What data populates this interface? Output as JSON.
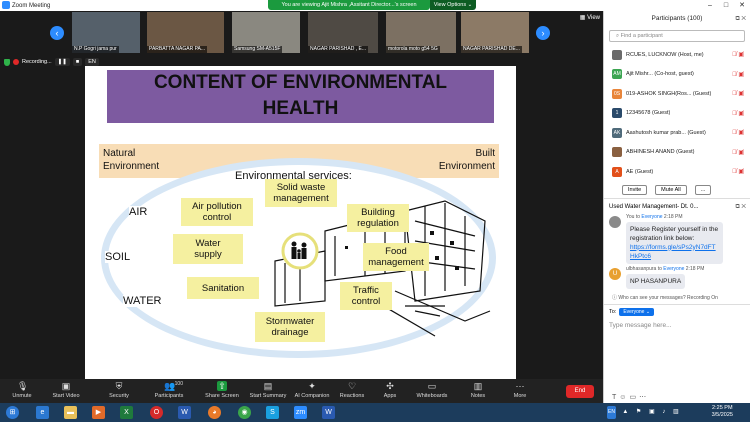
{
  "window": {
    "title": "Zoom Meeting"
  },
  "banner": {
    "viewing": "You are viewing Ajit Mishra ,Assitant Director...'s screen",
    "options": "View Options"
  },
  "thumbnails": [
    {
      "name": "N.P Gogri jama pur",
      "bg": "#55606a"
    },
    {
      "name": "PARBATTA NAGAR PA...",
      "bg": "#6b5744"
    },
    {
      "name": "Samsung SM-A515F",
      "bg": "#8a8880"
    },
    {
      "name": "NAGAR PARISHAD , E...",
      "bg": "#4f4a44"
    },
    {
      "name": "motorola moto g54 5G",
      "bg": "#7c7062"
    },
    {
      "name": "NAGAR PARISHAD DE...",
      "bg": "#8c7a66"
    }
  ],
  "view_label": "View",
  "recording": {
    "label": "Recording...",
    "lang": "EN"
  },
  "slide": {
    "title_line1": "CONTENT OF ENVIRONMENTAL",
    "title_line2": "HEALTH",
    "natural_env": [
      "Natural",
      "Environment"
    ],
    "built_env": [
      "Built",
      "Environment"
    ],
    "services_label": "Environmental services:",
    "air": "AIR",
    "soil": "SOIL",
    "water": "WATER",
    "boxes": {
      "air_pollution": [
        "Air pollution",
        "control"
      ],
      "solid_waste": [
        "Solid waste",
        "management"
      ],
      "building": [
        "Building",
        "regulation"
      ],
      "water_supply": [
        "Water",
        "supply"
      ],
      "food": [
        "Food",
        "management"
      ],
      "sanitation": "Sanitation",
      "traffic": [
        "Traffic",
        "control"
      ],
      "stormwater": [
        "Stormwater",
        "drainage"
      ]
    }
  },
  "toolbar": {
    "unmute": "Unmute",
    "video": "Start Video",
    "security": "Security",
    "participants": "Participants",
    "participants_count": "100",
    "share": "Share Screen",
    "summary": "Start Summary",
    "ai": "AI Companion",
    "reactions": "Reactions",
    "apps": "Apps",
    "whiteboards": "Whiteboards",
    "notes": "Notes",
    "more": "More",
    "end": "End"
  },
  "participants_panel": {
    "header": "Participants (100)",
    "search_placeholder": "Find a participant",
    "rows": [
      {
        "initials": "",
        "color": "#6a6a6a",
        "name": "RCUES, LUCKNOW (Host, me)"
      },
      {
        "initials": "AM",
        "color": "#3ca552",
        "name": "Ajit Mishr... (Co-host, guest)"
      },
      {
        "initials": "0S",
        "color": "#e8853a",
        "name": "019-ASHOK SINGH(Ros... (Guest)"
      },
      {
        "initials": "1",
        "color": "#2a4a6a",
        "name": "12345678 (Guest)"
      },
      {
        "initials": "AK",
        "color": "#4f6a7a",
        "name": "Aashutosh kumar prab... (Guest)"
      },
      {
        "initials": "",
        "color": "#8a6040",
        "name": "ABHINESH ANAND (Guest)"
      },
      {
        "initials": "A",
        "color": "#e2501a",
        "name": "AE (Guest)"
      }
    ],
    "invite": "Invite",
    "mute_all": "Mute All",
    "more": "..."
  },
  "chat": {
    "header": "Used Water Management- Dt. 0...",
    "messages": [
      {
        "sender": "You",
        "to": "Everyone",
        "time": "2:18 PM",
        "avatar_color": "#8a8a8a",
        "text": "Please Register yourself in the registration link below:",
        "link": "https://forms.gle/sPs2yN7dFTHkPtc6"
      },
      {
        "sender": "ulbhasanpura",
        "to": "Everyone",
        "time": "2:18 PM",
        "avatar_color": "#e8a030",
        "initial": "U",
        "text": "NP HASANPURA"
      }
    ],
    "who_can_see": "Who can see your messages? Recording On",
    "to_label": "To:",
    "to_value": "Everyone",
    "input_placeholder": "Type message here..."
  },
  "taskbar": {
    "time": "2:25 PM",
    "date": "3/5/2025"
  }
}
